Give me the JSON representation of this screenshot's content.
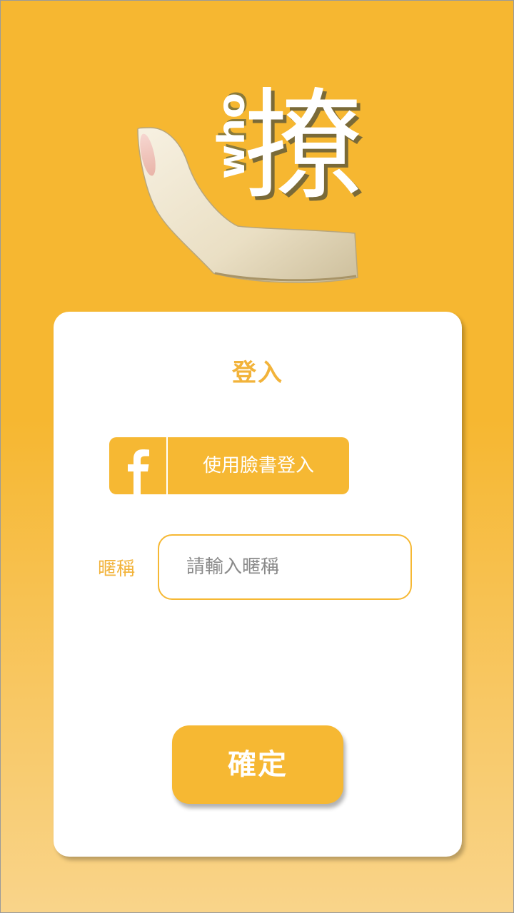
{
  "logo": {
    "who_text": "who",
    "main_char": "撩",
    "icon": "hand-icon"
  },
  "login_card": {
    "title": "登入",
    "facebook_button": {
      "icon": "facebook-icon",
      "label": "使用臉書登入"
    },
    "nickname": {
      "label": "暱稱",
      "placeholder": "請輸入暱稱",
      "value": ""
    },
    "confirm_label": "確定"
  },
  "colors": {
    "accent": "#f6b833",
    "background_top": "#f6b731",
    "background_bottom": "#f9d48a",
    "card": "#ffffff",
    "title_text": "#f2b33a"
  }
}
